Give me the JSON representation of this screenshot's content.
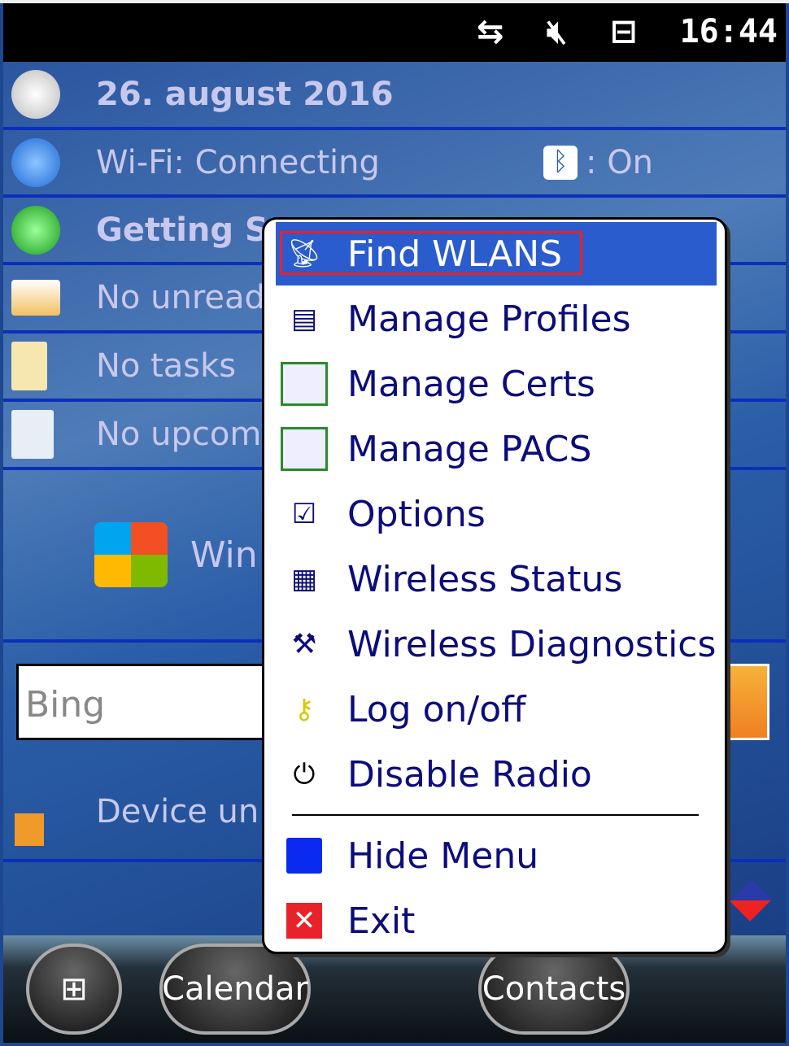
{
  "status_bar": {
    "time": "16:44",
    "icons": [
      "connectivity-arrows-icon",
      "speaker-muted-icon",
      "battery-charging-icon"
    ]
  },
  "today": {
    "date": "26. august 2016",
    "wifi": "Wi-Fi: Connecting",
    "bluetooth": ": On",
    "getting_started": "Getting St",
    "messages": "No unread",
    "tasks": "No tasks",
    "appointments": "No upcomi",
    "windows": "Win",
    "device_lock": "Device unlo"
  },
  "search": {
    "placeholder": "Bing"
  },
  "menu": {
    "items": [
      {
        "label": "Find WLANS",
        "icon": "find-wlans-icon",
        "selected": true
      },
      {
        "label": "Manage Profiles",
        "icon": "profiles-icon"
      },
      {
        "label": "Manage Certs",
        "icon": "certificate-icon"
      },
      {
        "label": "Manage PACS",
        "icon": "certificate-icon"
      },
      {
        "label": "Options",
        "icon": "options-icon"
      },
      {
        "label": "Wireless Status",
        "icon": "status-icon"
      },
      {
        "label": "Wireless Diagnostics",
        "icon": "diagnostics-icon"
      },
      {
        "label": "Log on/off",
        "icon": "key-icon"
      },
      {
        "label": "Disable Radio",
        "icon": "power-icon"
      },
      {
        "label": "Hide Menu",
        "icon": "minimize-icon"
      },
      {
        "label": "Exit",
        "icon": "close-icon"
      }
    ],
    "highlight_color": "#e8222a"
  },
  "taskbar": {
    "left": "Calendar",
    "right": "Contacts"
  }
}
